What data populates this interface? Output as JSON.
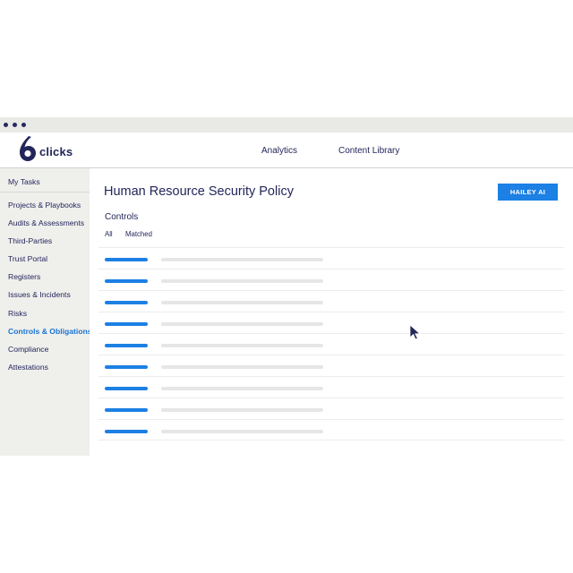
{
  "app": {
    "logo_text": "clicks",
    "logo_digit": "6"
  },
  "topnav": {
    "items": [
      "Analytics",
      "Content Library"
    ]
  },
  "sidebar": {
    "my_tasks": "My Tasks",
    "items": [
      {
        "label": "Projects & Playbooks",
        "active": false
      },
      {
        "label": "Audits & Assessments",
        "active": false
      },
      {
        "label": "Third-Parties",
        "active": false
      },
      {
        "label": "Trust Portal",
        "active": false
      },
      {
        "label": "Registers",
        "active": false
      },
      {
        "label": "Issues & Incidents",
        "active": false
      },
      {
        "label": "Risks",
        "active": false
      },
      {
        "label": "Controls & Obligations",
        "active": true
      },
      {
        "label": "Compliance",
        "active": false
      },
      {
        "label": "Attestations",
        "active": false
      }
    ]
  },
  "main": {
    "title": "Human Resource Security Policy",
    "action_button": "HAILEY AI",
    "section": "Controls",
    "filters": [
      "All",
      "Matched"
    ],
    "row_count": 9
  },
  "colors": {
    "accent": "#1c80e4",
    "brand": "#23265a",
    "sidebar_bg": "#efefec",
    "titlebar_bg": "#e9e9e6",
    "placeholder": "#e6e6e6"
  },
  "icons": {
    "logo": "six-logo-icon",
    "cursor": "mouse-pointer-icon"
  }
}
